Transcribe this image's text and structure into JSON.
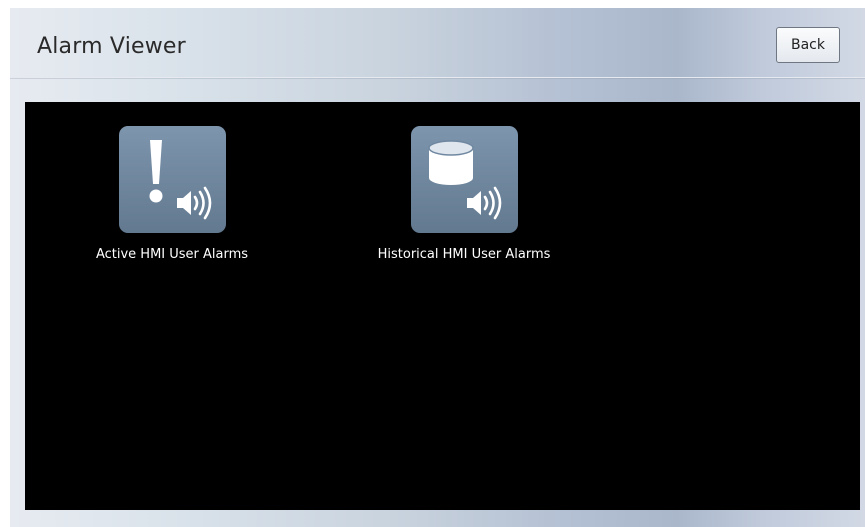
{
  "header": {
    "title": "Alarm Viewer",
    "back_label": "Back"
  },
  "tiles": [
    {
      "label": "Active HMI User Alarms",
      "icon": "exclamation-speaker-icon"
    },
    {
      "label": "Historical HMI User Alarms",
      "icon": "database-speaker-icon"
    }
  ],
  "colors": {
    "panel_background": "#000000",
    "tile_icon_background": "#6f87a0",
    "tile_label": "#ffffff",
    "title_text": "#2a2a2a"
  }
}
